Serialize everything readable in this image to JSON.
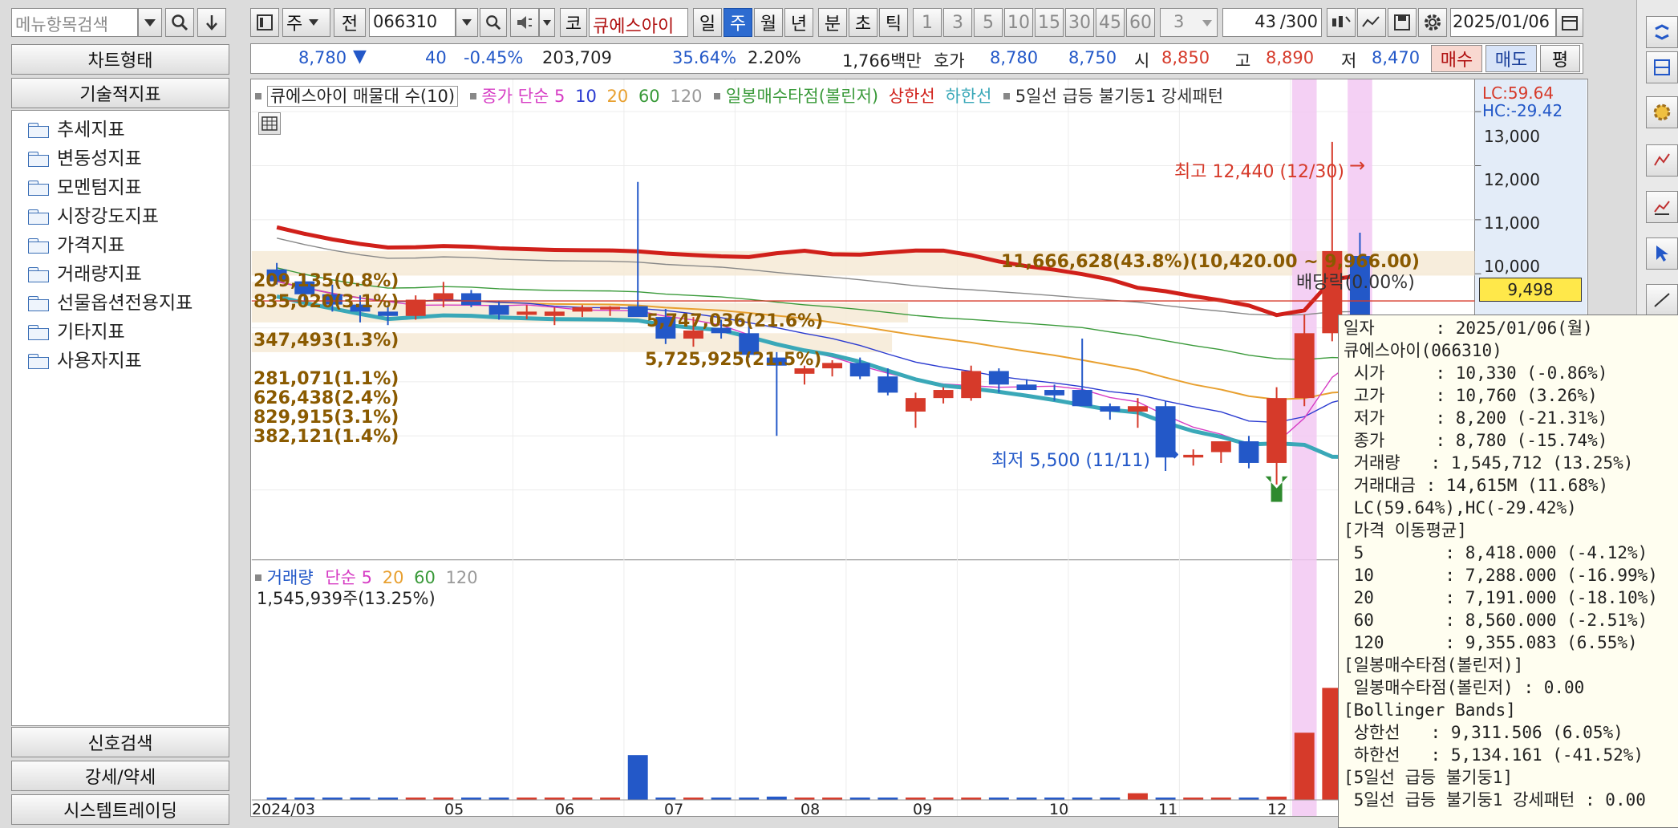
{
  "left_panel": {
    "search_placeholder": "메뉴항목검색",
    "chart_type_label": "차트형태",
    "tech_indicator_label": "기술적지표",
    "tree_items": [
      "추세지표",
      "변동성지표",
      "모멘텀지표",
      "시장강도지표",
      "가격지표",
      "거래량지표",
      "선물옵션전용지표",
      "기타지표",
      "사용자지표"
    ],
    "bottom_buttons": [
      "신호검색",
      "강세/약세",
      "시스템트레이딩"
    ]
  },
  "toolbar": {
    "type_label": "주",
    "prev_label": "전",
    "code_value": "066310",
    "market_label": "코",
    "stock_name": "큐에스아이",
    "periods": [
      "일",
      "주",
      "월",
      "년"
    ],
    "active_period": "주",
    "time_units": [
      "분",
      "초",
      "틱"
    ],
    "intervals": [
      "1",
      "3",
      "5",
      "10",
      "15",
      "30",
      "45",
      "60"
    ],
    "count_select": "3",
    "bar_count": "43",
    "bar_total": "/300",
    "date_value": "2025/01/06"
  },
  "quote_bar": {
    "price": "8,780",
    "change": "40",
    "change_pct": "-0.45%",
    "volume": "203,709",
    "pct1": "35.64%",
    "pct2": "2.20%",
    "amount": "1,766백만",
    "hoga_label": "호가",
    "bid": "8,780",
    "ask": "8,750",
    "open_label": "시",
    "open": "8,850",
    "high_label": "고",
    "high": "8,890",
    "low_label": "저",
    "low": "8,470",
    "buy_label": "매수",
    "sell_label": "매도",
    "avg_label": "평"
  },
  "price_legend": {
    "title": "큐에스아이 매물대 수(10)",
    "close_label": "종가 단순 5",
    "ma10": "10",
    "ma20": "20",
    "ma60": "60",
    "ma120": "120",
    "buy_point": "일봉매수타점(볼린저)",
    "upper": "상한선",
    "lower": "하한선",
    "pattern": "5일선 급등 불기둥1 강세패턴"
  },
  "price_axis": {
    "lc": "LC:59.64",
    "hc": "HC:-29.42",
    "ticks": [
      "13,000",
      "12,000",
      "11,000",
      "10,000"
    ],
    "current_price_tag": "9,498"
  },
  "annotations": {
    "high_label": "최고 12,440 (12/30)",
    "low_label": "최저 5,500 (11/11)",
    "dividend": "배당락(0.00%)",
    "vp_main": "11,666,628(43.8%)(10,420.00 ~ 9,966.00)",
    "vp_mid1": "5,747,036(21.6%)",
    "vp_mid2": "5,725,925(21.5%)",
    "vp_left": [
      "209,135(0.8%)",
      "835,020(3.1%)",
      "347,493(1.3%)",
      "281,071(1.1%)",
      "626,438(2.4%)",
      "829,915(3.1%)",
      "382,121(1.4%)"
    ]
  },
  "volume_legend": {
    "title": "거래량",
    "ma_label": "단순 5",
    "ma20": "20",
    "ma60": "60",
    "ma120": "120",
    "value": "1,545,939주(13.25%)"
  },
  "x_axis": [
    "2024/03",
    "05",
    "06",
    "07",
    "08",
    "09",
    "10",
    "11",
    "12"
  ],
  "tooltip": {
    "lines": [
      "일자      : 2025/01/06(월)",
      "큐에스아이(066310)",
      " 시가     : 10,330 (-0.86%)",
      " 고가     : 10,760 (3.26%)",
      " 저가     : 8,200 (-21.31%)",
      " 종가     : 8,780 (-15.74%)",
      " 거래량   : 1,545,712 (13.25%)",
      " 거래대금 : 14,615M (11.68%)",
      " LC(59.64%),HC(-29.42%)",
      "[가격 이동평균]",
      " 5        : 8,418.000 (-4.12%)",
      " 10       : 7,288.000 (-16.99%)",
      " 20       : 7,191.000 (-18.10%)",
      " 60       : 8,560.000 (-2.51%)",
      " 120      : 9,355.083 (6.55%)",
      "[일봉매수타점(볼린저)]",
      " 일봉매수타점(볼린저) : 0.00",
      "[Bollinger Bands]",
      " 상한선   : 9,311.506 (6.05%)",
      " 하한선   : 5,134.161 (-41.52%)",
      "[5일선 급등 불기둥1]",
      " 5일선 급등 불기둥1 강세패턴 : 0.00"
    ]
  },
  "colors": {
    "up": "#d63a2a",
    "down": "#2358c8",
    "ma5": "#d63cc4",
    "ma10": "#2a3ad0",
    "ma20": "#e8a030",
    "ma60": "#3a9a3a",
    "ma120": "#888888",
    "upper_band": "#d0201a",
    "lower_band": "#3aa8b8",
    "highlight": "#f2c8f2"
  },
  "chart_data": {
    "type": "candlestick",
    "candles": [
      {
        "o": 10080,
        "h": 10200,
        "l": 9800,
        "c": 9860
      },
      {
        "o": 9860,
        "h": 10000,
        "l": 9480,
        "c": 9620
      },
      {
        "o": 9620,
        "h": 9800,
        "l": 9300,
        "c": 9430
      },
      {
        "o": 9430,
        "h": 9600,
        "l": 9100,
        "c": 9300
      },
      {
        "o": 9300,
        "h": 9420,
        "l": 9050,
        "c": 9220
      },
      {
        "o": 9220,
        "h": 9600,
        "l": 9150,
        "c": 9520
      },
      {
        "o": 9520,
        "h": 9850,
        "l": 9380,
        "c": 9640
      },
      {
        "o": 9640,
        "h": 9700,
        "l": 9380,
        "c": 9420
      },
      {
        "o": 9420,
        "h": 9500,
        "l": 9150,
        "c": 9240
      },
      {
        "o": 9240,
        "h": 9420,
        "l": 9160,
        "c": 9300
      },
      {
        "o": 9220,
        "h": 9380,
        "l": 9050,
        "c": 9300
      },
      {
        "o": 9300,
        "h": 9420,
        "l": 9200,
        "c": 9380
      },
      {
        "o": 9340,
        "h": 9400,
        "l": 9220,
        "c": 9390
      },
      {
        "o": 9400,
        "h": 11700,
        "l": 9250,
        "c": 9200
      },
      {
        "o": 9200,
        "h": 9350,
        "l": 8700,
        "c": 8800
      },
      {
        "o": 8800,
        "h": 9200,
        "l": 8650,
        "c": 8950
      },
      {
        "o": 9000,
        "h": 9150,
        "l": 8800,
        "c": 8900
      },
      {
        "o": 8900,
        "h": 9050,
        "l": 8450,
        "c": 8500
      },
      {
        "o": 8450,
        "h": 8550,
        "l": 7000,
        "c": 8300
      },
      {
        "o": 8150,
        "h": 8300,
        "l": 7950,
        "c": 8250
      },
      {
        "o": 8250,
        "h": 8400,
        "l": 8100,
        "c": 8350
      },
      {
        "o": 8350,
        "h": 8450,
        "l": 8050,
        "c": 8100
      },
      {
        "o": 8100,
        "h": 8250,
        "l": 7750,
        "c": 7800
      },
      {
        "o": 7450,
        "h": 7800,
        "l": 7150,
        "c": 7700
      },
      {
        "o": 7700,
        "h": 7900,
        "l": 7600,
        "c": 7850
      },
      {
        "o": 7700,
        "h": 8300,
        "l": 7650,
        "c": 8200
      },
      {
        "o": 8200,
        "h": 8250,
        "l": 7800,
        "c": 7950
      },
      {
        "o": 7950,
        "h": 8050,
        "l": 7850,
        "c": 7850
      },
      {
        "o": 7850,
        "h": 7950,
        "l": 7650,
        "c": 7750
      },
      {
        "o": 7850,
        "h": 8800,
        "l": 7650,
        "c": 7550
      },
      {
        "o": 7550,
        "h": 7600,
        "l": 7300,
        "c": 7450
      },
      {
        "o": 7450,
        "h": 7700,
        "l": 7150,
        "c": 7550
      },
      {
        "o": 7550,
        "h": 7650,
        "l": 6350,
        "c": 6600
      },
      {
        "o": 6600,
        "h": 6750,
        "l": 6450,
        "c": 6650
      },
      {
        "o": 6700,
        "h": 6900,
        "l": 6500,
        "c": 6900
      },
      {
        "o": 6900,
        "h": 7000,
        "l": 6400,
        "c": 6500
      },
      {
        "o": 6500,
        "h": 7900,
        "l": 6100,
        "c": 7700
      },
      {
        "o": 7700,
        "h": 9250,
        "l": 7550,
        "c": 8900
      },
      {
        "o": 8900,
        "h": 12440,
        "l": 8750,
        "c": 10420
      },
      {
        "o": 10330,
        "h": 10760,
        "l": 8200,
        "c": 8780
      }
    ],
    "volume": [
      2,
      1,
      1,
      1,
      1,
      1,
      1,
      1,
      1,
      1,
      1,
      1,
      1,
      40,
      2,
      1,
      1,
      1,
      3,
      1,
      1,
      1,
      1,
      2,
      1,
      1,
      1,
      1,
      1,
      1,
      1,
      6,
      1,
      1,
      1,
      1,
      3,
      60,
      100,
      70
    ],
    "ylim": [
      5300,
      13300
    ]
  }
}
